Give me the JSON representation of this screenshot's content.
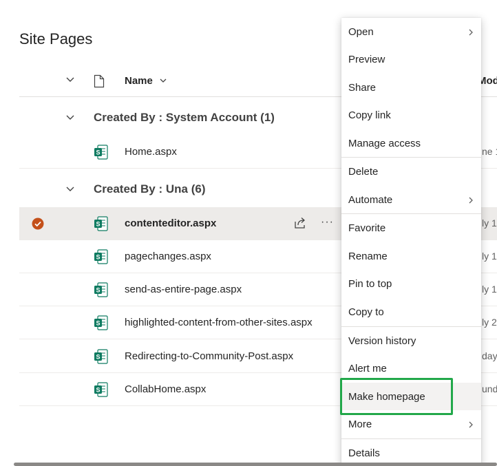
{
  "page": {
    "title": "Site Pages"
  },
  "columns": {
    "name": "Name",
    "modified": "Mod"
  },
  "groups": [
    {
      "label": "Created By : System Account (1)"
    },
    {
      "label": "Created By : Una (6)"
    }
  ],
  "files": [
    {
      "name": "Home.aspx",
      "modified": "ne 1"
    },
    {
      "name": "contenteditor.aspx",
      "modified": "ly 1"
    },
    {
      "name": "pagechanges.aspx",
      "modified": "ly 1"
    },
    {
      "name": "send-as-entire-page.aspx",
      "modified": "ly 1"
    },
    {
      "name": "highlighted-content-from-other-sites.aspx",
      "modified": "ly 2"
    },
    {
      "name": "Redirecting-to-Community-Post.aspx",
      "modified": "days"
    },
    {
      "name": "CollabHome.aspx",
      "modified": "unda"
    }
  ],
  "menu": {
    "items": [
      {
        "label": "Open"
      },
      {
        "label": "Preview"
      },
      {
        "label": "Share"
      },
      {
        "label": "Copy link"
      },
      {
        "label": "Manage access"
      },
      {
        "label": "Delete"
      },
      {
        "label": "Automate"
      },
      {
        "label": "Favorite"
      },
      {
        "label": "Rename"
      },
      {
        "label": "Pin to top"
      },
      {
        "label": "Copy to"
      },
      {
        "label": "Version history"
      },
      {
        "label": "Alert me"
      },
      {
        "label": "Make homepage"
      },
      {
        "label": "More"
      },
      {
        "label": "Details"
      }
    ]
  },
  "colors": {
    "accent_check": "#c4501a",
    "highlight": "#22a84a",
    "file_icon_green": "#0f7b61",
    "selected_row": "#edebe9"
  },
  "icons": {
    "file": "sharepoint-page-icon",
    "check": "check-circle-icon",
    "share": "share-icon",
    "more": "more-icon"
  }
}
